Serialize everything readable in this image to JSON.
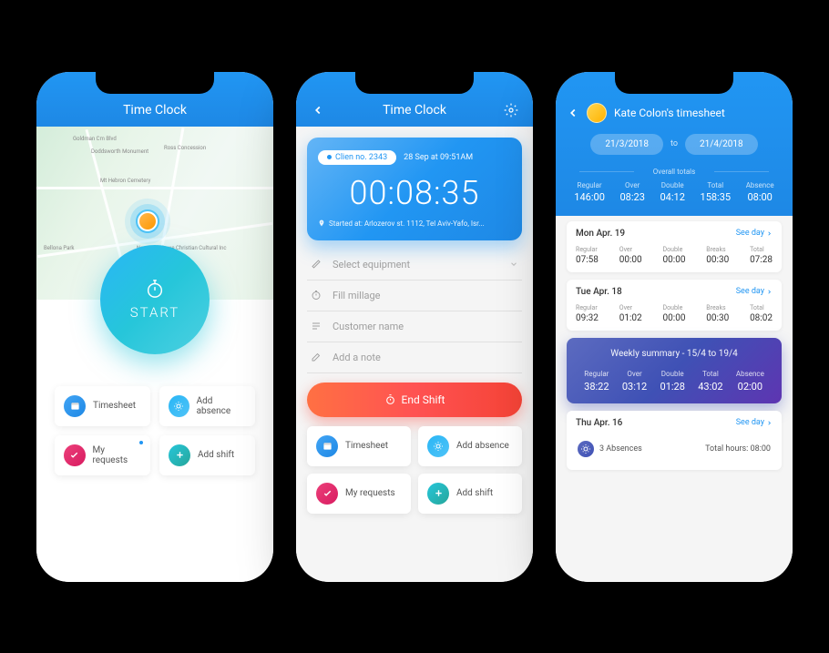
{
  "phone1": {
    "header_title": "Time Clock",
    "start_label": "START",
    "map_labels": [
      "Goldman Cm Blvd",
      "Doddsworth Monument",
      "Ross Concession",
      "Mt Hebron Cemetery",
      "New York Sowe Christian Cultural Inc",
      "Bellona Park"
    ],
    "tiles": [
      {
        "label": "Timesheet",
        "icon": "calendar",
        "color": "blue"
      },
      {
        "label": "Add absence",
        "icon": "sun",
        "color": "bluelt"
      },
      {
        "label": "My requests",
        "icon": "check",
        "color": "pink",
        "dot": true
      },
      {
        "label": "Add shift",
        "icon": "plus",
        "color": "teal"
      }
    ]
  },
  "phone2": {
    "header_title": "Time Clock",
    "client_chip": "Clien no. 2343",
    "timestamp": "28 Sep at 09:51AM",
    "timer": "00:08:35",
    "location": "Started at: Arlozerov st. 1112, Tel Aviv-Yafo, Isr...",
    "form": [
      {
        "icon": "equipment",
        "label": "Select equipment",
        "chev": true
      },
      {
        "icon": "millage",
        "label": "Fill millage"
      },
      {
        "icon": "customer",
        "label": "Customer name"
      },
      {
        "icon": "note",
        "label": "Add a note"
      }
    ],
    "end_label": "End Shift",
    "tiles": [
      {
        "label": "Timesheet",
        "icon": "calendar",
        "color": "blue"
      },
      {
        "label": "Add absence",
        "icon": "sun",
        "color": "bluelt"
      },
      {
        "label": "My requests",
        "icon": "check",
        "color": "pink"
      },
      {
        "label": "Add shift",
        "icon": "plus",
        "color": "teal"
      }
    ]
  },
  "phone3": {
    "title": "Kate Colon's timesheet",
    "date_from": "21/3/2018",
    "date_to_label": "to",
    "date_to": "21/4/2018",
    "overall_label": "Overall totals",
    "overall": [
      {
        "h": "Regular",
        "v": "146:00"
      },
      {
        "h": "Over",
        "v": "08:23"
      },
      {
        "h": "Double",
        "v": "04:12"
      },
      {
        "h": "Total",
        "v": "158:35"
      },
      {
        "h": "Absence",
        "v": "08:00"
      }
    ],
    "see_day_label": "See day",
    "days": [
      {
        "date": "Mon Apr. 19",
        "stats": [
          {
            "h": "Regular",
            "v": "07:58"
          },
          {
            "h": "Over",
            "v": "00:00"
          },
          {
            "h": "Double",
            "v": "00:00"
          },
          {
            "h": "Breaks",
            "v": "00:30"
          },
          {
            "h": "Total",
            "v": "07:28"
          }
        ]
      },
      {
        "date": "Tue Apr. 18",
        "stats": [
          {
            "h": "Regular",
            "v": "09:32"
          },
          {
            "h": "Over",
            "v": "01:02"
          },
          {
            "h": "Double",
            "v": "00:00"
          },
          {
            "h": "Breaks",
            "v": "00:30"
          },
          {
            "h": "Total",
            "v": "08:02"
          }
        ]
      }
    ],
    "week": {
      "title": "Weekly summary - 15/4 to 19/4",
      "stats": [
        {
          "h": "Regular",
          "v": "38:22"
        },
        {
          "h": "Over",
          "v": "03:12"
        },
        {
          "h": "Double",
          "v": "01:28"
        },
        {
          "h": "Total",
          "v": "43:02"
        },
        {
          "h": "Absence",
          "v": "02:00"
        }
      ]
    },
    "thu": {
      "date": "Thu Apr. 16",
      "absences": "3 Absences",
      "total_label": "Total hours: 08:00"
    }
  }
}
